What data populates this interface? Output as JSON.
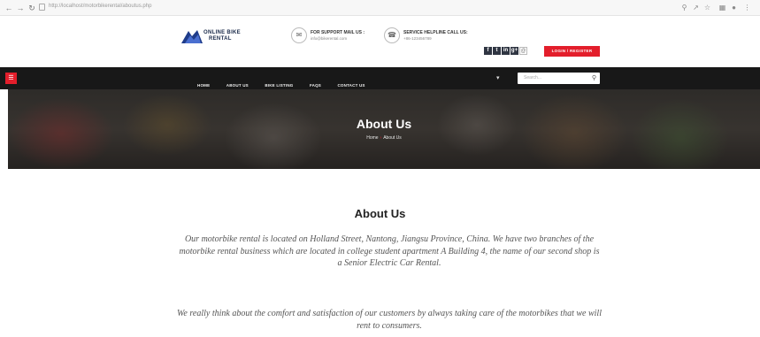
{
  "browser": {
    "url": "http://localhost/motorbikerental/aboutus.php"
  },
  "header": {
    "logo_line1": "ONLINE BIKE",
    "logo_line2": "RENTAL",
    "support": {
      "title": "FOR SUPPORT MAIL US :",
      "value": "info@bikerental.com"
    },
    "service": {
      "title": "SERVICE HELPLINE CALL US:",
      "value": "+86-123456789"
    },
    "socials": [
      "f",
      "t",
      "in",
      "g+",
      "@"
    ],
    "cta_label": "LOGIN / REGISTER"
  },
  "nav": {
    "links": [
      "HOME",
      "ABOUT US",
      "BIKE LISTING",
      "FAQS",
      "CONTACT US"
    ],
    "search_placeholder": "Search..."
  },
  "hero": {
    "title": "About Us",
    "crumb_home": "Home",
    "crumb_current": "About Us"
  },
  "main": {
    "title": "About Us",
    "paragraph1": "Our motorbike rental is located on Holland Street, Nantong, Jiangsu Province, China. We have two branches of the motorbike rental business which are located in college student apartment A Building 4, the name of our second shop is a Senior Electric Car Rental.",
    "paragraph2": "We really think about the comfort and satisfaction of our customers by always taking care of the motorbikes that we will rent to consumers."
  },
  "colors": {
    "accent": "#e31e2b",
    "navbar": "#181818",
    "logo": "#1a2a4a"
  }
}
